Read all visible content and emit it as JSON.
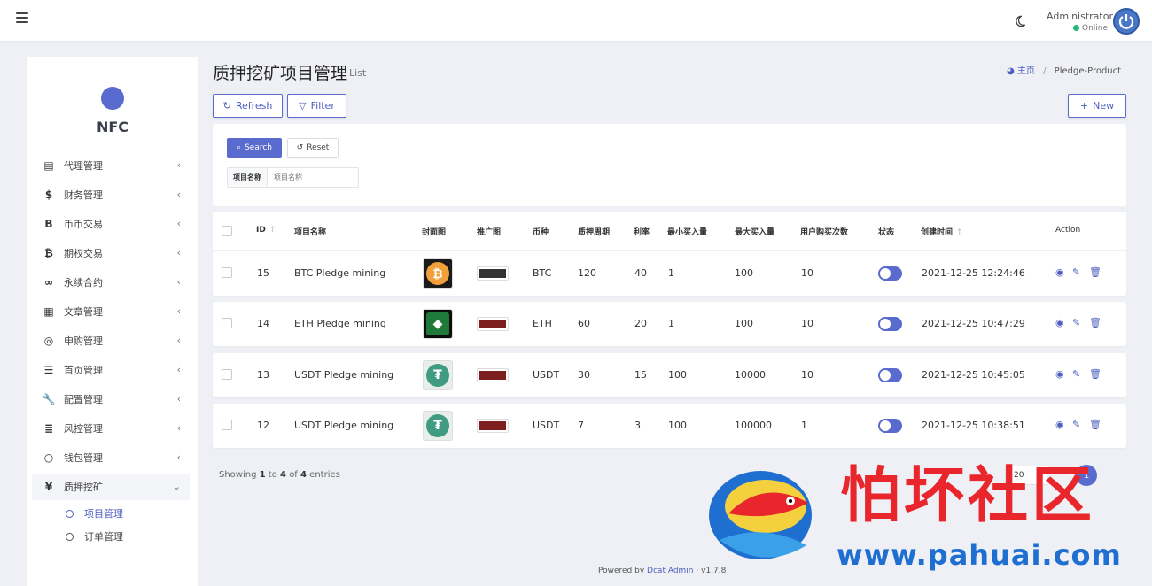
{
  "header": {
    "admin_name": "Administrator",
    "status": "Online"
  },
  "sidebar": {
    "logo_text": "NFC",
    "items": [
      {
        "label": "代理管理",
        "icon": "id-card-icon"
      },
      {
        "label": "财务管理",
        "icon": "dollar-icon"
      },
      {
        "label": "币币交易",
        "icon": "bitcoin-b-icon"
      },
      {
        "label": "期权交易",
        "icon": "bitcoin-icon"
      },
      {
        "label": "永续合约",
        "icon": "link-icon"
      },
      {
        "label": "文章管理",
        "icon": "newspaper-icon"
      },
      {
        "label": "申购管理",
        "icon": "lifebuoy-icon"
      },
      {
        "label": "首页管理",
        "icon": "list-icon"
      },
      {
        "label": "配置管理",
        "icon": "wrench-icon"
      },
      {
        "label": "风控管理",
        "icon": "indent-icon"
      },
      {
        "label": "钱包管理",
        "icon": "circle-icon"
      },
      {
        "label": "质押挖矿",
        "icon": "yen-icon"
      }
    ],
    "sub_items": [
      {
        "label": "项目管理",
        "active": true
      },
      {
        "label": "订单管理",
        "active": false
      }
    ]
  },
  "page": {
    "title": "质押挖矿项目管理",
    "subtitle": "List",
    "breadcrumb_home": "主页",
    "breadcrumb_current": "Pledge-Product"
  },
  "toolbar": {
    "refresh": "Refresh",
    "filter": "Filter",
    "new": "New"
  },
  "filter": {
    "search": "Search",
    "reset": "Reset",
    "field_label": "项目名称",
    "field_placeholder": "项目名称"
  },
  "table": {
    "columns": [
      "ID",
      "项目名称",
      "封面图",
      "推广图",
      "币种",
      "质押周期",
      "利率",
      "最小买入量",
      "最大买入量",
      "用户购买次数",
      "状态",
      "创建时间",
      "Action"
    ],
    "rows": [
      {
        "id": "15",
        "name": "BTC Pledge mining",
        "coin": "BTC",
        "period": "120",
        "rate": "40",
        "min": "1",
        "max": "100",
        "times": "10",
        "created": "2021-12-25 12:24:46"
      },
      {
        "id": "14",
        "name": "ETH Pledge mining",
        "coin": "ETH",
        "period": "60",
        "rate": "20",
        "min": "1",
        "max": "100",
        "times": "10",
        "created": "2021-12-25 10:47:29"
      },
      {
        "id": "13",
        "name": "USDT Pledge mining",
        "coin": "USDT",
        "period": "30",
        "rate": "15",
        "min": "100",
        "max": "10000",
        "times": "10",
        "created": "2021-12-25 10:45:05"
      },
      {
        "id": "12",
        "name": "USDT Pledge mining",
        "coin": "USDT",
        "period": "7",
        "rate": "3",
        "min": "100",
        "max": "100000",
        "times": "1",
        "created": "2021-12-25 10:38:51"
      }
    ]
  },
  "pagination": {
    "showing_prefix": "Showing",
    "from": "1",
    "to_word": "to",
    "to": "4",
    "of_word": "of",
    "total": "4",
    "suffix": "entries",
    "per_page": "20",
    "current_page": "1"
  },
  "footer": {
    "powered": "Powered by",
    "brand": "Dcat Admin",
    "sep": "·",
    "version": "v1.7.8"
  },
  "watermark": {
    "title": "怕坏社区",
    "url": "www.pahuai.com"
  },
  "colors": {
    "accent": "#5a6bcf",
    "online": "#21b978",
    "watermark_red": "#e8262b",
    "watermark_blue": "#1f6fd1"
  }
}
